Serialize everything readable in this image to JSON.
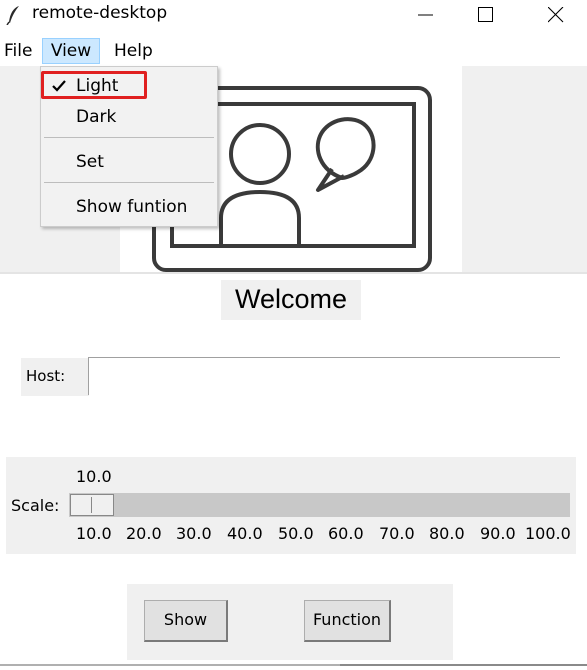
{
  "window": {
    "title": "remote-desktop",
    "icon": "feather-icon"
  },
  "menubar": {
    "file": "File",
    "view": "View",
    "help": "Help"
  },
  "view_menu": {
    "items": [
      {
        "label": "Light",
        "checked": true
      },
      {
        "label": "Dark",
        "checked": false
      },
      {
        "label": "Set",
        "checked": false
      },
      {
        "label": "Show funtion",
        "checked": false
      }
    ],
    "highlight_color": "#e02020"
  },
  "hero_image": {
    "icon": "video-chat-illustration"
  },
  "welcome": {
    "text": "Welcome"
  },
  "host": {
    "label": "Host:",
    "value": ""
  },
  "scale": {
    "label": "Scale:",
    "current": "10.0",
    "ticks": [
      "10.0",
      "20.0",
      "30.0",
      "40.0",
      "50.0",
      "60.0",
      "70.0",
      "80.0",
      "90.0",
      "100.0"
    ]
  },
  "buttons": {
    "show": "Show",
    "function": "Function"
  },
  "colors": {
    "menu_active_bg": "#cce8ff",
    "frame_bg": "#f0f0f0"
  }
}
